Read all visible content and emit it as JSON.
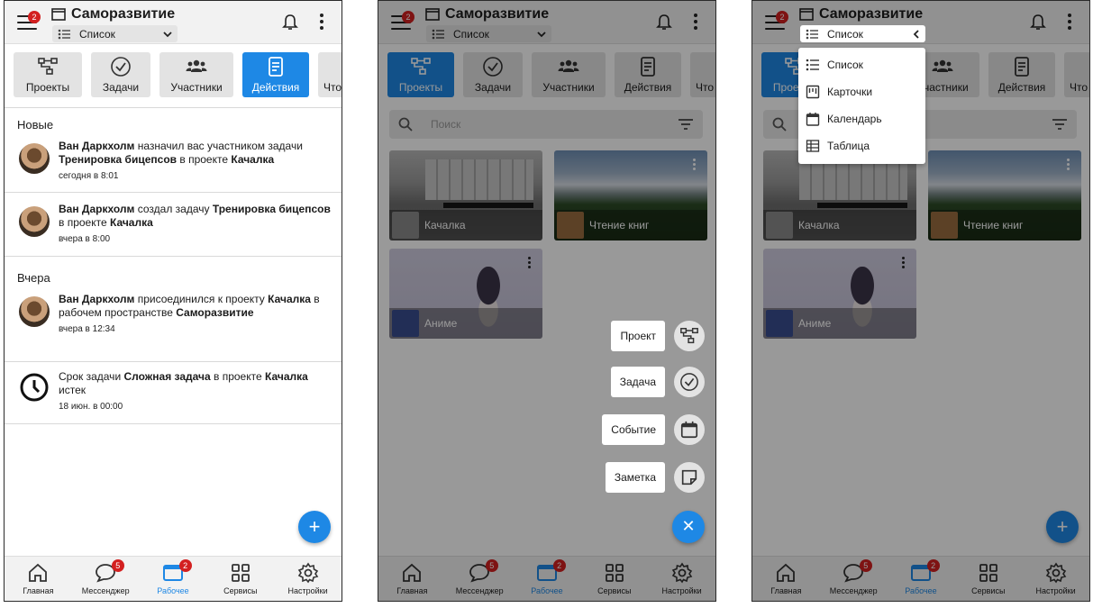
{
  "header": {
    "title": "Саморазвитие",
    "view": "Список",
    "menu_badge": "2"
  },
  "tabs": [
    {
      "label": "Проекты",
      "icon": "projects-icon"
    },
    {
      "label": "Задачи",
      "icon": "check-circle-icon"
    },
    {
      "label": "Участники",
      "icon": "people-icon"
    },
    {
      "label": "Действия",
      "icon": "document-icon"
    },
    {
      "label": "Что",
      "icon": ""
    }
  ],
  "screen1": {
    "section_new": "Новые",
    "section_yesterday": "Вчера",
    "notifs": [
      {
        "name": "Ван Даркхолм",
        "action": " назначил вас участником задачи ",
        "task": "Тренировка бицепсов",
        "mid": " в проекте ",
        "project": "Качалка",
        "time": "сегодня в 8:01"
      },
      {
        "name": "Ван Даркхолм",
        "action": " создал задачу ",
        "task": "Тренировка бицепсов",
        "mid": " в проекте ",
        "project": "Качалка",
        "time": "вчера в 8:00"
      },
      {
        "name": "Ван Даркхолм",
        "action": " присоединился к проекту ",
        "project": "Качалка",
        "mid": " в рабочем пространстве ",
        "space": "Саморазвитие",
        "time": "вчера в 12:34"
      },
      {
        "pre": "Срок задачи ",
        "task": "Сложная задача",
        "mid": " в проекте ",
        "project": "Качалка",
        "post": " истек",
        "time": "18 июн. в 00:00"
      }
    ]
  },
  "search": {
    "placeholder": "Поиск"
  },
  "projects": [
    {
      "name": "Качалка"
    },
    {
      "name": "Чтение книг"
    },
    {
      "name": "Аниме"
    }
  ],
  "fab_menu": [
    "Проект",
    "Задача",
    "Событие",
    "Заметка"
  ],
  "view_options": [
    "Список",
    "Карточки",
    "Календарь",
    "Таблица"
  ],
  "nav": [
    {
      "label": "Главная"
    },
    {
      "label": "Мессенджер",
      "badge": "5"
    },
    {
      "label": "Рабочее",
      "badge": "2"
    },
    {
      "label": "Сервисы"
    },
    {
      "label": "Настройки"
    }
  ],
  "colors": {
    "accent": "#1e88e5",
    "badge": "#d32020"
  }
}
